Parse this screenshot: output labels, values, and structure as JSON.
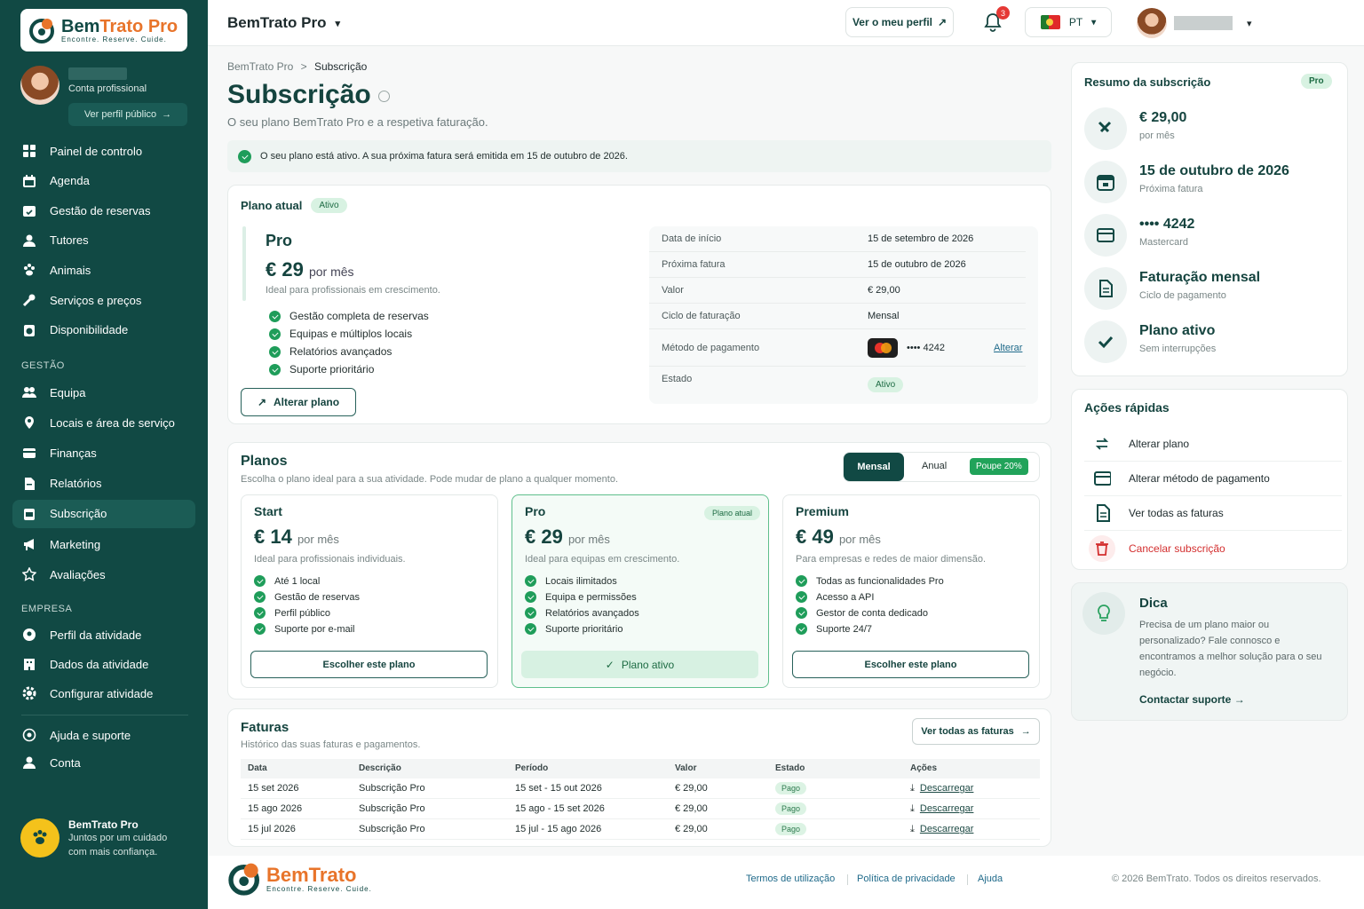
{
  "app": {
    "brand": "BemTrato Pro",
    "brand_a": "Bem",
    "brand_b": "Trato Pro",
    "tagline": "Encontre. Reserve. Cuide."
  },
  "profile": {
    "role": "Conta profissional",
    "public_button": "Ver perfil público"
  },
  "nav": {
    "main": [
      {
        "label": "Painel de controlo",
        "icon": "dashboard-icon"
      },
      {
        "label": "Agenda",
        "icon": "calendar-icon"
      },
      {
        "label": "Gestão de reservas",
        "icon": "calendar-check-icon"
      },
      {
        "label": "Tutores",
        "icon": "user-icon"
      },
      {
        "label": "Animais",
        "icon": "paw-icon"
      },
      {
        "label": "Serviços e preços",
        "icon": "wrench-icon"
      },
      {
        "label": "Disponibilidade",
        "icon": "clock-icon"
      }
    ],
    "gestao_label": "GESTÃO",
    "gestao": [
      {
        "label": "Equipa",
        "icon": "team-icon"
      },
      {
        "label": "Locais e área de serviço",
        "icon": "location-icon"
      },
      {
        "label": "Finanças",
        "icon": "wallet-icon"
      },
      {
        "label": "Relatórios",
        "icon": "report-icon"
      },
      {
        "label": "Subscrição",
        "icon": "subscription-icon",
        "active": true
      },
      {
        "label": "Marketing",
        "icon": "megaphone-icon"
      },
      {
        "label": "Avaliações",
        "icon": "star-icon"
      }
    ],
    "empresa_label": "EMPRESA",
    "empresa": [
      {
        "label": "Perfil da atividade",
        "icon": "profile-badge-icon"
      },
      {
        "label": "Dados da atividade",
        "icon": "building-icon"
      },
      {
        "label": "Configurar atividade",
        "icon": "gear-icon"
      }
    ],
    "bottom": [
      {
        "label": "Ajuda e suporte",
        "icon": "help-icon"
      },
      {
        "label": "Conta",
        "icon": "account-icon"
      }
    ]
  },
  "sidebar_footer": {
    "title": "BemTrato Pro",
    "text": "Juntos por um cuidado com mais confiança."
  },
  "topbar": {
    "title": "BemTrato Pro",
    "view_profile": "Ver o meu perfil",
    "notifications": "3",
    "language": "PT"
  },
  "page": {
    "breadcrumb_root": "BemTrato Pro",
    "breadcrumb_sep": ">",
    "breadcrumb_current": "Subscrição",
    "title": "Subscrição",
    "subtitle": "O seu plano BemTrato Pro e a respetiva faturação.",
    "alert": "O seu plano está ativo. A sua próxima fatura será emitida em 15 de outubro de 2026."
  },
  "current_plan": {
    "heading": "Plano atual",
    "status": "Ativo",
    "name": "Pro",
    "price": "€ 29",
    "period": "por mês",
    "desc": "Ideal para profissionais em crescimento.",
    "features": [
      "Gestão completa de reservas",
      "Equipas e múltiplos locais",
      "Relatórios avançados",
      "Suporte prioritário"
    ],
    "change_button": "Alterar plano",
    "details": [
      {
        "k": "Data de início",
        "v": "15 de setembro de 2026"
      },
      {
        "k": "Próxima fatura",
        "v": "15 de outubro de 2026"
      },
      {
        "k": "Valor",
        "v": "€ 29,00"
      },
      {
        "k": "Ciclo de faturação",
        "v": "Mensal"
      }
    ],
    "payment_label": "Método de pagamento",
    "card_mask": "•••• 4242",
    "change_link": "Alterar",
    "status_label": "Estado",
    "status_value": "Ativo"
  },
  "plans": {
    "title": "Planos",
    "subtitle": "Escolha o plano ideal para a sua atividade. Pode mudar de plano a qualquer momento.",
    "toggle": {
      "monthly": "Mensal",
      "annual": "Anual",
      "save": "Poupe 20%"
    },
    "items": [
      {
        "name": "Start",
        "price": "€ 14",
        "period": "por mês",
        "desc": "Ideal para profissionais individuais.",
        "features": [
          "Até 1 local",
          "Gestão de reservas",
          "Perfil público",
          "Suporte por e-mail"
        ],
        "button": "Escolher este plano"
      },
      {
        "name": "Pro",
        "badge": "Plano atual",
        "price": "€ 29",
        "period": "por mês",
        "desc": "Ideal para equipas em crescimento.",
        "features": [
          "Locais ilimitados",
          "Equipa e permissões",
          "Relatórios avançados",
          "Suporte prioritário"
        ],
        "button": "Plano ativo"
      },
      {
        "name": "Premium",
        "price": "€ 49",
        "period": "por mês",
        "desc": "Para empresas e redes de maior dimensão.",
        "features": [
          "Todas as funcionalidades Pro",
          "Acesso a API",
          "Gestor de conta dedicado",
          "Suporte 24/7"
        ],
        "button": "Escolher este plano"
      }
    ]
  },
  "invoices": {
    "title": "Faturas",
    "subtitle": "Histórico das suas faturas e pagamentos.",
    "view_all": "Ver todas as faturas",
    "columns": [
      "Data",
      "Descrição",
      "Período",
      "Valor",
      "Estado",
      "Ações"
    ],
    "rows": [
      {
        "date": "15 set 2026",
        "desc": "Subscrição Pro",
        "period": "15 set - 15 out 2026",
        "value": "€ 29,00",
        "status": "Pago",
        "action": "Descarregar"
      },
      {
        "date": "15 ago 2026",
        "desc": "Subscrição Pro",
        "period": "15 ago - 15 set 2026",
        "value": "€ 29,00",
        "status": "Pago",
        "action": "Descarregar"
      },
      {
        "date": "15 jul 2026",
        "desc": "Subscrição Pro",
        "period": "15 jul - 15 ago 2026",
        "value": "€ 29,00",
        "status": "Pago",
        "action": "Descarregar"
      }
    ]
  },
  "summary": {
    "title": "Resumo da subscrição",
    "badge": "Pro",
    "items": [
      {
        "main": "€ 29,00",
        "sub": "por mês",
        "icon": "money-icon"
      },
      {
        "main": "15 de outubro de 2026",
        "sub": "Próxima fatura",
        "icon": "calendar-icon"
      },
      {
        "main": "•••• 4242",
        "sub": "Mastercard",
        "icon": "card-icon"
      },
      {
        "main": "Faturação mensal",
        "sub": "Ciclo de pagamento",
        "icon": "document-icon"
      },
      {
        "main": "Plano ativo",
        "sub": "Sem interrupções",
        "icon": "check-icon"
      }
    ]
  },
  "quick_actions": {
    "title": "Ações rápidas",
    "items": [
      {
        "label": "Alterar plano",
        "icon": "swap-icon"
      },
      {
        "label": "Alterar método de pagamento",
        "icon": "card-icon"
      },
      {
        "label": "Ver todas as faturas",
        "icon": "document-icon"
      },
      {
        "label": "Cancelar subscrição",
        "icon": "trash-icon",
        "danger": true
      }
    ]
  },
  "tip": {
    "title": "Dica",
    "text": "Precisa de um plano maior ou personalizado? Fale connosco e encontramos a melhor solução para o seu negócio.",
    "link": "Contactar suporte"
  },
  "footer": {
    "brand": "BemTrato",
    "tagline": "Encontre. Reserve. Cuide.",
    "links": [
      "Termos de utilização",
      "Política de privacidade",
      "Ajuda"
    ],
    "copyright": "© 2026 BemTrato. Todos os direitos reservados."
  },
  "colors": {
    "primary": "#114944",
    "accent": "#1f9d5a",
    "danger": "#d32f2f"
  }
}
